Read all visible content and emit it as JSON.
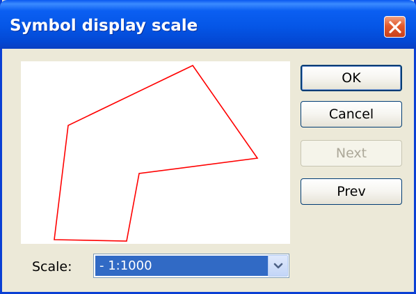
{
  "window": {
    "title": "Symbol display scale"
  },
  "icons": {
    "close": "close-icon",
    "dropdown": "chevron-down-icon"
  },
  "buttons": {
    "ok": {
      "label": "OK",
      "enabled": true,
      "default": true
    },
    "cancel": {
      "label": "Cancel",
      "enabled": true
    },
    "next": {
      "label": "Next",
      "enabled": false
    },
    "prev": {
      "label": "Prev",
      "enabled": true
    }
  },
  "scale": {
    "label": "Scale:",
    "selected": "- 1:1000"
  },
  "preview": {
    "shape_color": "#ff0000"
  },
  "colors": {
    "title_bar": "#0556e6",
    "close_button": "#e25a2c",
    "selection": "#316ac5",
    "dialog_bg": "#ece9d8"
  }
}
